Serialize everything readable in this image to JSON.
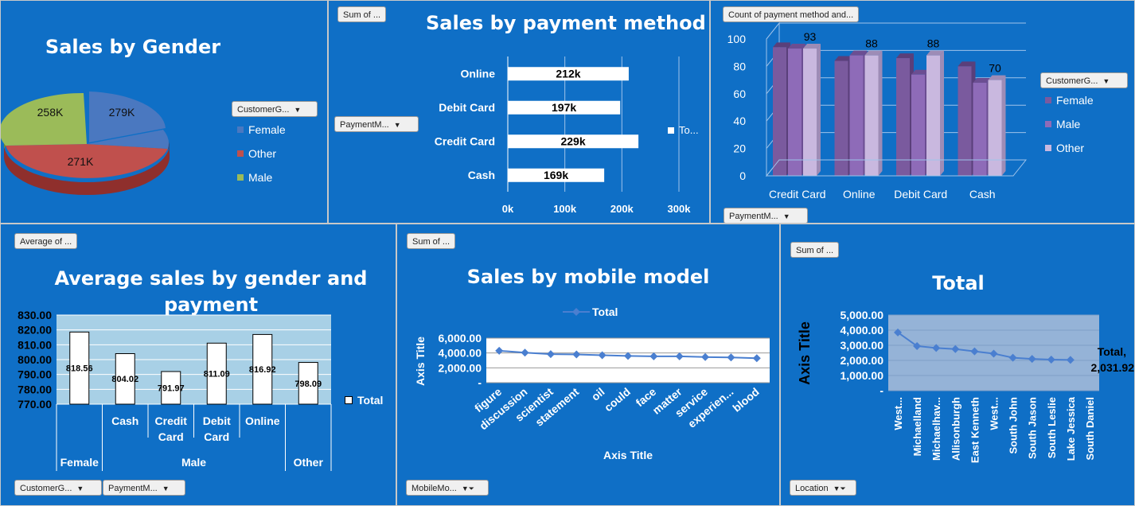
{
  "colors": {
    "background": "#0f6fc6",
    "female_pie": "#4a78c0",
    "other_pie": "#c0504d",
    "male_pie": "#9bbb59",
    "female_bar": "#7a5a9e",
    "male_bar": "#8e6bb8",
    "other_bar": "#c9b8df"
  },
  "gender": {
    "title": "Sales by Gender",
    "filter_label": "CustomerG...",
    "legend": [
      "Female",
      "Other",
      "Male"
    ],
    "chart_data": {
      "type": "pie",
      "title": "Sales by Gender",
      "labels": [
        "Female",
        "Other",
        "Male"
      ],
      "values": [
        279,
        271,
        258
      ],
      "value_labels": [
        "279K",
        "271K",
        "258K"
      ]
    }
  },
  "payment": {
    "title": "Sales by payment method",
    "sum_label": "Sum of ...",
    "filter_label": "PaymentM...",
    "legend_label": "To...",
    "chart_data": {
      "type": "bar",
      "title": "Sales by payment method",
      "categories": [
        "Online",
        "Debit Card",
        "Credit Card",
        "Cash"
      ],
      "values": [
        212,
        197,
        229,
        169
      ],
      "value_labels": [
        "212k",
        "197k",
        "229k",
        "169k"
      ],
      "xlim": [
        0,
        300
      ],
      "xticks": [
        "0k",
        "100k",
        "200k",
        "300k"
      ]
    }
  },
  "count": {
    "count_label": "Count of payment method and...",
    "gender_filter": "CustomerG...",
    "payment_filter": "PaymentM...",
    "legend": [
      "Female",
      "Male",
      "Other"
    ],
    "chart_data": {
      "type": "bar",
      "categories": [
        "Credit Card",
        "Online",
        "Debit Card",
        "Cash"
      ],
      "ylim": [
        0,
        100
      ],
      "yticks": [
        "0",
        "20",
        "40",
        "60",
        "80",
        "100"
      ],
      "series": [
        {
          "name": "Female",
          "values": [
            94,
            84,
            86,
            80
          ]
        },
        {
          "name": "Male",
          "values": [
            93,
            88,
            74,
            68
          ]
        },
        {
          "name": "Other",
          "values": [
            93,
            88,
            88,
            70
          ]
        }
      ],
      "data_labels": [
        "93",
        "88",
        "88",
        "70"
      ]
    }
  },
  "average": {
    "title": "Average sales by gender and payment",
    "avg_label": "Average of ...",
    "gender_filter": "CustomerG...",
    "payment_filter": "PaymentM...",
    "legend_label": "Total",
    "chart_data": {
      "type": "bar",
      "title": "Average sales by gender and payment",
      "categories": [
        "Female",
        "Cash",
        "Credit Card",
        "Debit Card",
        "Online",
        "Other"
      ],
      "groups": [
        "Female",
        "Male",
        "Other"
      ],
      "values": [
        818.56,
        804.02,
        791.97,
        811.09,
        816.92,
        798.09
      ],
      "value_labels": [
        "818.56",
        "804.02",
        "791.97",
        "811.09",
        "816.92",
        "798.09"
      ],
      "ylim": [
        770,
        830
      ],
      "yticks": [
        "770.00",
        "780.00",
        "790.00",
        "800.00",
        "810.00",
        "820.00",
        "830.00"
      ]
    }
  },
  "mobile": {
    "title": "Sales by mobile model",
    "sum_label": "Sum of ...",
    "filter_label": "MobileMo...",
    "legend_label": "Total",
    "xlabel": "Axis Title",
    "ylabel": "Axis Title",
    "chart_data": {
      "type": "line",
      "title": "Sales by mobile model",
      "categories": [
        "figure",
        "discussion",
        "scientist",
        "statement",
        "oil",
        "could",
        "face",
        "matter",
        "service",
        "experien...",
        "blood"
      ],
      "values": [
        4300,
        4050,
        3850,
        3800,
        3700,
        3600,
        3550,
        3550,
        3450,
        3400,
        3300
      ],
      "ylim": [
        0,
        6000
      ],
      "yticks": [
        "-",
        "2,000.00",
        "4,000.00",
        "6,000.00"
      ],
      "series": [
        {
          "name": "Total"
        }
      ]
    }
  },
  "location": {
    "title": "Total",
    "sum_label": "Sum of ...",
    "filter_label": "Location",
    "ylabel": "Axis Title",
    "point_label": "Total,\n2,031.92",
    "point_label_a": "Total,",
    "point_label_b": "2,031.92",
    "chart_data": {
      "type": "line",
      "title": "Total",
      "categories": [
        "West...",
        "Michaelland",
        "Michaelhav...",
        "Allisonburgh",
        "East Kenneth",
        "West...",
        "South John",
        "South Jason",
        "South Leslie",
        "Lake Jessica",
        "South Daniel"
      ],
      "values": [
        3850,
        2950,
        2820,
        2750,
        2600,
        2450,
        2180,
        2100,
        2050,
        2031.92
      ],
      "ylim": [
        0,
        5000
      ],
      "yticks": [
        "-",
        "1,000.00",
        "2,000.00",
        "3,000.00",
        "4,000.00",
        "5,000.00"
      ]
    }
  }
}
